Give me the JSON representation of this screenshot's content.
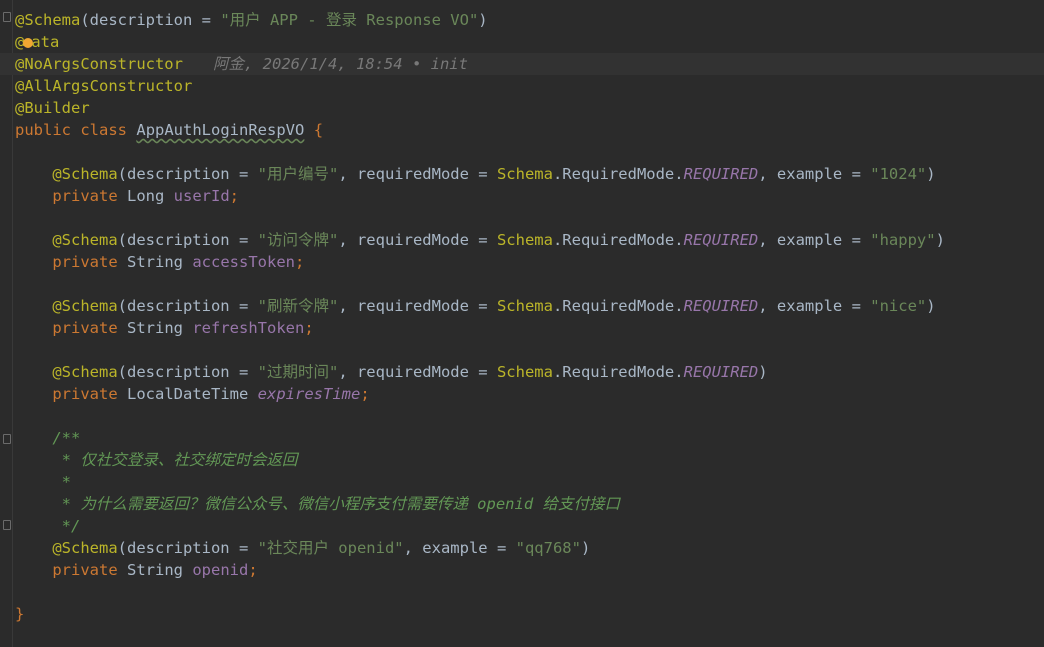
{
  "colors": {
    "background": "#2b2b2b",
    "annotation": "#bbb529",
    "keyword": "#cc7832",
    "string": "#6a8759",
    "field": "#9876aa",
    "comment": "#629755",
    "default": "#a9b7c6"
  },
  "blame": {
    "author": "阿金",
    "date": ", 2026/1/4, 18:54 • init"
  },
  "lines": {
    "l1": {
      "ann": "@Schema",
      "open": "(description = ",
      "str": "\"用户 APP - 登录 Response VO\"",
      "close": ")"
    },
    "l2": {
      "ann_a": "@",
      "ann_b": "ata"
    },
    "l3": {
      "ann": "@NoArgsConstructor"
    },
    "l4": {
      "ann": "@AllArgsConstructor"
    },
    "l5": {
      "ann": "@Builder"
    },
    "l6": {
      "kw1": "public",
      "kw2": "class",
      "name": "AppAuthLoginRespVO",
      "brace": "{"
    },
    "f1": {
      "ann": "@Schema",
      "a": "(description = ",
      "desc": "\"用户编号\"",
      "b": ", requiredMode = ",
      "schema": "Schema",
      "c": ".RequiredMode.",
      "req": "REQUIRED",
      "d": ", example = ",
      "ex": "\"1024\"",
      "e": ")",
      "kw": "private",
      "type": "Long",
      "name": "userId",
      "semi": ";"
    },
    "f2": {
      "ann": "@Schema",
      "a": "(description = ",
      "desc": "\"访问令牌\"",
      "b": ", requiredMode = ",
      "schema": "Schema",
      "c": ".RequiredMode.",
      "req": "REQUIRED",
      "d": ", example = ",
      "ex": "\"happy\"",
      "e": ")",
      "kw": "private",
      "type": "String",
      "name": "accessToken",
      "semi": ";"
    },
    "f3": {
      "ann": "@Schema",
      "a": "(description = ",
      "desc": "\"刷新令牌\"",
      "b": ", requiredMode = ",
      "schema": "Schema",
      "c": ".RequiredMode.",
      "req": "REQUIRED",
      "d": ", example = ",
      "ex": "\"nice\"",
      "e": ")",
      "kw": "private",
      "type": "String",
      "name": "refreshToken",
      "semi": ";"
    },
    "f4": {
      "ann": "@Schema",
      "a": "(description = ",
      "desc": "\"过期时间\"",
      "b": ", requiredMode = ",
      "schema": "Schema",
      "c": ".RequiredMode.",
      "req": "REQUIRED",
      "e": ")",
      "kw": "private",
      "type": "LocalDateTime",
      "name": "expiresTime",
      "semi": ";"
    },
    "doc": {
      "open": "/**",
      "l1": " * 仅社交登录、社交绑定时会返回",
      "l2": " *",
      "l3a": " * 为什么需要返回？微信公众号、微信小程序支付需要传递 ",
      "l3b": "openid",
      "l3c": " 给支付接口",
      "close": " */"
    },
    "f5": {
      "ann": "@Schema",
      "a": "(description = ",
      "desc": "\"社交用户 openid\"",
      "d": ", example = ",
      "ex": "\"qq768\"",
      "e": ")",
      "kw": "private",
      "type": "String",
      "name": "openid",
      "semi": ";"
    },
    "end": {
      "brace": "}"
    }
  }
}
